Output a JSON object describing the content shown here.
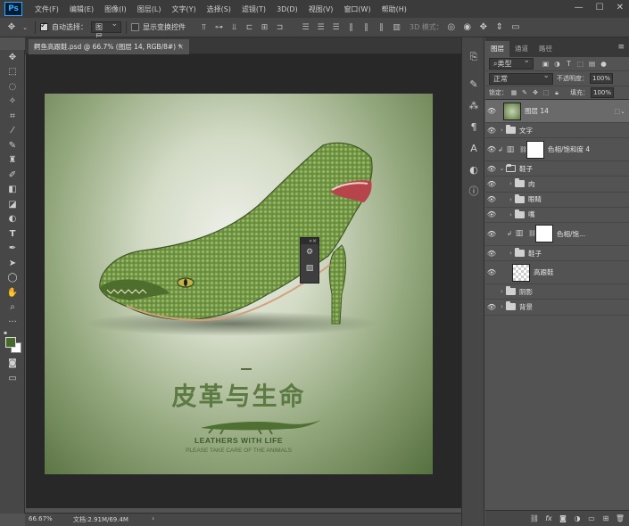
{
  "menubar": {
    "logo": "Ps",
    "items": [
      "文件(F)",
      "编辑(E)",
      "图像(I)",
      "图层(L)",
      "文字(Y)",
      "选择(S)",
      "滤镜(T)",
      "3D(D)",
      "视图(V)",
      "窗口(W)",
      "帮助(H)"
    ],
    "controls": {
      "minimize": "—",
      "maximize": "☐",
      "close": "✕"
    }
  },
  "options": {
    "auto_select_label": "自动选择：",
    "auto_select_checked": true,
    "auto_select_target": "图层",
    "show_transform_label": "显示变换控件",
    "mode_3d_label": "3D 模式："
  },
  "document": {
    "tab_title": "鳄鱼高跟鞋.psd @ 66.7% (图层 14, RGB/8#) *",
    "close": "×"
  },
  "canvas": {
    "title": "皮革与生命",
    "subtitle": "LEATHERS WITH LIFE",
    "tagline": "PLEASE TAKE CARE OF THE ANIMALS"
  },
  "status": {
    "zoom": "66.67%",
    "doc_info": "文档:2.91M/69.4M",
    "arrow": "›"
  },
  "colors": {
    "foreground": "#466a2b",
    "background": "#ffffff",
    "accent": "#31a8ff"
  },
  "layers_panel": {
    "tabs": [
      "图层",
      "通道",
      "路径"
    ],
    "active_tab": "图层",
    "menu_icon": "≡",
    "filter_label": "⌕类型",
    "blend_mode": "正常",
    "opacity_label": "不透明度：",
    "opacity_value": "100%",
    "lock_label": "锁定：",
    "fill_label": "填充：",
    "fill_value": "100%",
    "layers": [
      {
        "name": "图层 14",
        "kind": "photo",
        "visible": true,
        "selected": true,
        "indent": 0
      },
      {
        "name": "文字",
        "kind": "group",
        "visible": true,
        "indent": 0
      },
      {
        "name": "色相/饱和度 4",
        "kind": "adjust",
        "visible": true,
        "indent": 0
      },
      {
        "name": "鞋子",
        "kind": "group-open",
        "visible": true,
        "indent": 0
      },
      {
        "name": "肉",
        "kind": "group",
        "visible": true,
        "indent": 1
      },
      {
        "name": "眼睛",
        "kind": "group",
        "visible": true,
        "indent": 1
      },
      {
        "name": "嘴",
        "kind": "group",
        "visible": true,
        "indent": 1
      },
      {
        "name": "色相/饱...",
        "kind": "adjust",
        "visible": true,
        "indent": 1
      },
      {
        "name": "鞋子",
        "kind": "group",
        "visible": true,
        "indent": 1
      },
      {
        "name": "高跟鞋",
        "kind": "checker",
        "visible": true,
        "indent": 1
      },
      {
        "name": "阴影",
        "kind": "group",
        "visible": false,
        "indent": 0
      },
      {
        "name": "背景",
        "kind": "group",
        "visible": true,
        "indent": 0
      }
    ]
  }
}
